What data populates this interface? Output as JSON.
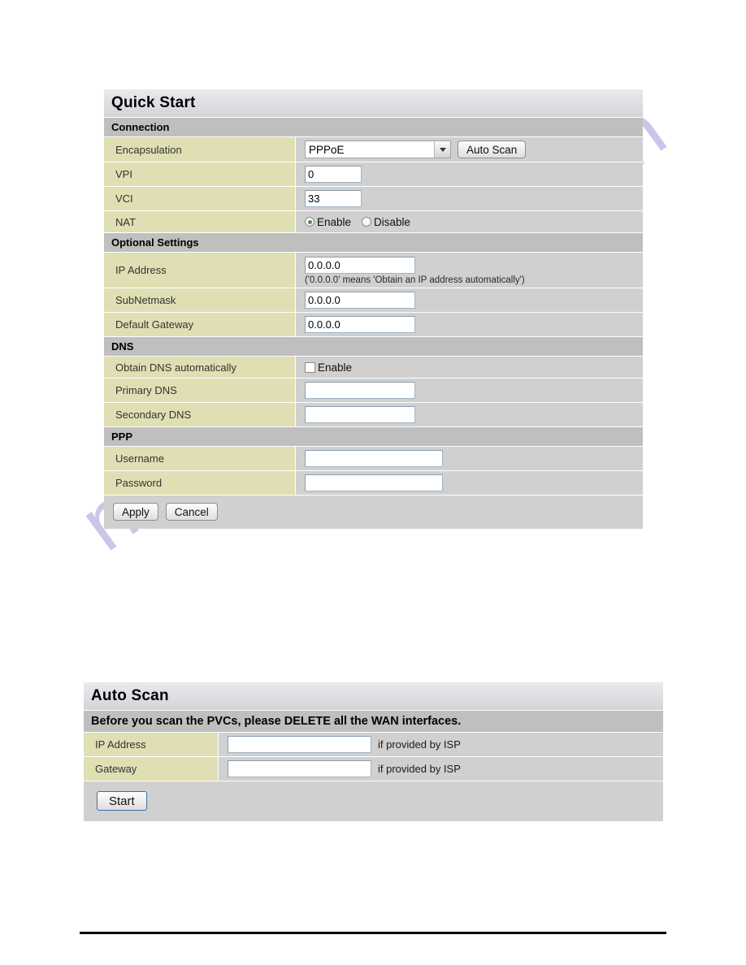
{
  "watermark": {
    "text": "manualshive.com",
    "color": "#a9a6dd"
  },
  "quick_start": {
    "title": "Quick Start",
    "sections": {
      "connection": {
        "header": "Connection",
        "encapsulation": {
          "label": "Encapsulation",
          "value": "PPPoE",
          "options": [
            "PPPoE"
          ],
          "auto_scan_button": "Auto Scan"
        },
        "vpi": {
          "label": "VPI",
          "value": "0"
        },
        "vci": {
          "label": "VCI",
          "value": "33"
        },
        "nat": {
          "label": "NAT",
          "enable_label": "Enable",
          "disable_label": "Disable",
          "selected": "Enable"
        }
      },
      "optional_settings": {
        "header": "Optional Settings",
        "ip_address": {
          "label": "IP Address",
          "value": "0.0.0.0",
          "hint": "('0.0.0.0' means 'Obtain an IP address automatically')"
        },
        "subnetmask": {
          "label": "SubNetmask",
          "value": "0.0.0.0"
        },
        "default_gateway": {
          "label": "Default Gateway",
          "value": "0.0.0.0"
        }
      },
      "dns": {
        "header": "DNS",
        "obtain_dns": {
          "label": "Obtain DNS automatically",
          "enable_label": "Enable",
          "checked": "false"
        },
        "primary_dns": {
          "label": "Primary DNS",
          "value": "",
          "placeholder": ""
        },
        "secondary_dns": {
          "label": "Secondary DNS",
          "value": "",
          "placeholder": ""
        }
      },
      "ppp": {
        "header": "PPP",
        "username": {
          "label": "Username",
          "value": "",
          "placeholder": ""
        },
        "password": {
          "label": "Password",
          "value": "",
          "placeholder": ""
        }
      }
    },
    "buttons": {
      "apply": "Apply",
      "cancel": "Cancel"
    }
  },
  "auto_scan": {
    "title": "Auto Scan",
    "notice": "Before you scan the PVCs, please DELETE all the WAN interfaces.",
    "ip_address": {
      "label": "IP Address",
      "value": "",
      "placeholder": "",
      "hint": "if provided by ISP"
    },
    "gateway": {
      "label": "Gateway",
      "value": "",
      "placeholder": "",
      "hint": "if provided by ISP"
    },
    "buttons": {
      "start": "Start"
    }
  }
}
